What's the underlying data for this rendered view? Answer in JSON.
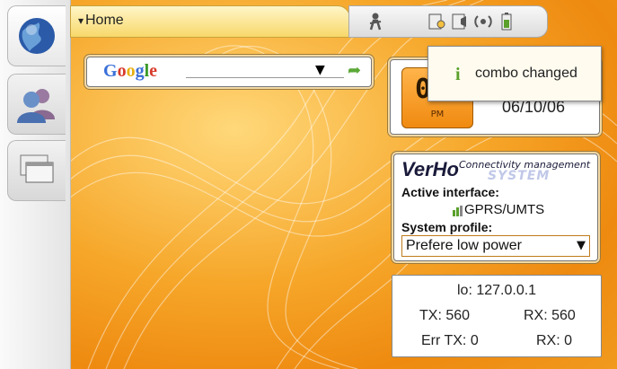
{
  "window": {
    "title": "Home"
  },
  "taskbar": {
    "items": [
      {
        "icon": "globe-icon"
      },
      {
        "icon": "contacts-icon"
      },
      {
        "icon": "windows-icon"
      }
    ]
  },
  "statusbar": {
    "icons": [
      "person-icon",
      "brightness-icon",
      "volume-icon",
      "signal-icon",
      "battery-icon"
    ]
  },
  "google": {
    "logo": "Google",
    "dropdown_arrow": "▼",
    "go": "➦"
  },
  "clock": {
    "digits": "03",
    "ampm": "PM",
    "date": "06/10/06"
  },
  "verho": {
    "logo": "VerHo",
    "tagline": "Connectivity management",
    "system": "SYSTEM",
    "active_label": "Active interface:",
    "active_value": "GPRS/UMTS",
    "profile_label": "System profile:",
    "profile_value": "Prefere low power",
    "profile_arrow": "▼"
  },
  "stats": {
    "lo": "lo: 127.0.0.1",
    "tx": "TX: 560",
    "rx": "RX: 560",
    "errtx": "Err TX: 0",
    "errrx": "RX: 0"
  },
  "notification": {
    "icon": "i",
    "text": "combo changed"
  },
  "colors": {
    "desktop": "#f6a72a",
    "accent": "#f08a10",
    "notif_icon": "#5aa02a"
  }
}
